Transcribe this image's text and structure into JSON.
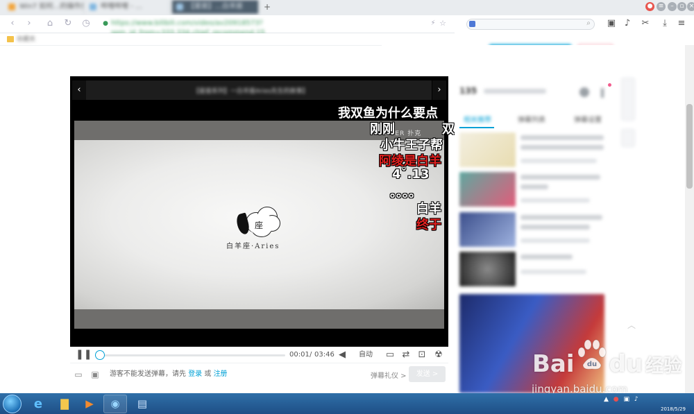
{
  "browser": {
    "tabs": [
      {
        "title": "Win7 如何…的操作步骤"
      },
      {
        "title": "哔哩哔哩 - …"
      },
      {
        "title": "【星座】…白羊座"
      }
    ],
    "address": "https://www.bilibili.com/video/av20918573?spm_id_from=333.334.chief_recommend.15",
    "bookmark": "收藏夹"
  },
  "player": {
    "title": "【星座系列】一白羊座Aries先生的故事】",
    "poker_tag": "POKER 扑克",
    "logo_text": "座",
    "logo_caption": "白羊座·Aries",
    "danmaku": [
      {
        "text": "我双鱼为什么要点",
        "color": "#ffffff"
      },
      {
        "text": "刚刚",
        "color": "#ffffff"
      },
      {
        "text": "双",
        "color": "#ffffff"
      },
      {
        "text": "小牛王子帮",
        "color": "#ffffff"
      },
      {
        "text": "阿绫是白羊",
        "color": "#e0201f"
      },
      {
        "text": "4ˇ.13",
        "color": "#ffffff"
      },
      {
        "text": "。。。。",
        "color": "#ffffff"
      },
      {
        "text": "白羊",
        "color": "#ffffff"
      },
      {
        "text": "终于",
        "color": "#e0201f"
      }
    ],
    "progress": 0.004,
    "current_time": "00:01",
    "separator": "/",
    "duration": "03:46",
    "quality": "自动",
    "guest_prefix": "游客不能发送弹幕，请先",
    "login": "登录",
    "or": "或",
    "register": "注册",
    "gift": "弹幕礼仪 >",
    "send": "发送 >"
  },
  "side": {
    "viewer_count": "135",
    "tabs": [
      "相关推荐",
      "弹幕列表",
      "弹幕设置"
    ]
  },
  "watermark": {
    "brand": "Bai",
    "brand2": "du",
    "brand_cn": "经验",
    "url": "jingyan.baidu.com"
  },
  "taskbar": {
    "date": "2018/5/29"
  },
  "colors": {
    "accent": "#00a1d6",
    "danmaku_red": "#e0201f",
    "taskbar": "#2f6fa8"
  }
}
